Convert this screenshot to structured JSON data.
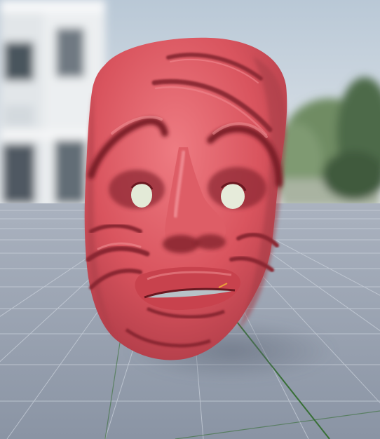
{
  "scene": {
    "subject_icon": "mask-icon",
    "colors": {
      "sky_top": "#b9c8d6",
      "sky_bottom": "#dfe5ea",
      "building": "#eceff1",
      "building_shadow": "#cfd5da",
      "window": "#2f3a44",
      "trees": "#6b8a5e",
      "trees_dark": "#3f5a3c",
      "ground": "#8e98a8",
      "ground_far": "#aab2bf",
      "grid_line": "#c5ccd6",
      "axis_line": "#2f6b2a",
      "mask_base": "#d9545e",
      "mask_light": "#f07b82",
      "mask_shadow": "#9e2f3a",
      "mask_deep": "#6a1820",
      "eye_hole": "#e7ecd9",
      "mouth_gap": "#b9c3c8",
      "marker": "#e8a23a"
    }
  }
}
